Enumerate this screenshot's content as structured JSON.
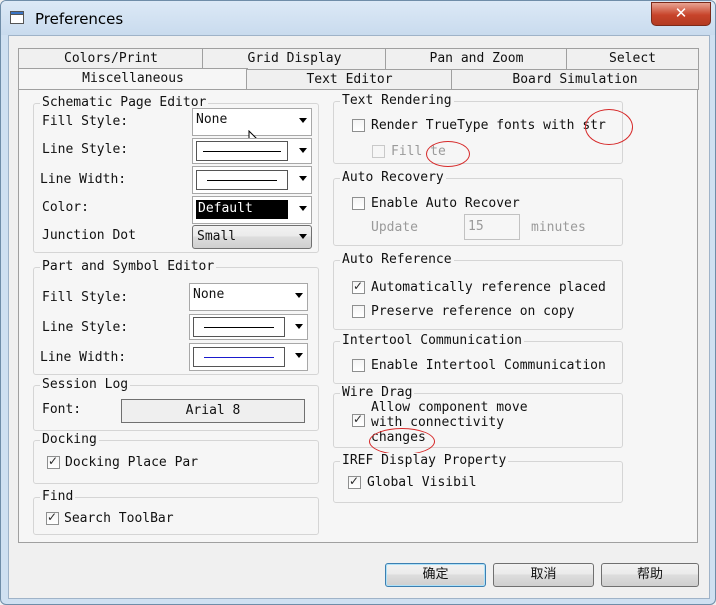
{
  "window": {
    "title": "Preferences",
    "close_glyph": "✕"
  },
  "tabs": {
    "row1": [
      "Colors/Print",
      "Grid Display",
      "Pan and Zoom",
      "Select"
    ],
    "row2": [
      "Miscellaneous",
      "Text Editor",
      "Board Simulation"
    ],
    "selected": "Miscellaneous"
  },
  "schematic": {
    "title": "Schematic Page Editor",
    "fill_style_label": "Fill Style:",
    "fill_style_value": "None",
    "line_style_label": "Line Style:",
    "line_width_label": "Line Width:",
    "color_label": "Color:",
    "color_value": "Default",
    "junction_label": "Junction Dot",
    "junction_value": "Small"
  },
  "part_symbol": {
    "title": "Part and Symbol Editor",
    "fill_style_label": "Fill Style:",
    "fill_style_value": "None",
    "line_style_label": "Line Style:",
    "line_width_label": "Line Width:"
  },
  "session_log": {
    "title": "Session Log",
    "font_label": "Font:",
    "font_button": "Arial 8"
  },
  "docking": {
    "title": "Docking",
    "checkbox_label": "Docking Place Par",
    "checked": true
  },
  "find": {
    "title": "Find",
    "checkbox_label": "Search ToolBar",
    "checked": true
  },
  "text_rendering": {
    "title": "Text Rendering",
    "render_label": "Render TrueType fonts with str",
    "render_checked": false,
    "fill_label": "Fill te",
    "fill_checked": false
  },
  "auto_recovery": {
    "title": "Auto Recovery",
    "enable_label": "Enable Auto Recover",
    "enable_checked": false,
    "update_label": "Update",
    "update_value": "15",
    "minutes_label": "minutes"
  },
  "auto_reference": {
    "title": "Auto Reference",
    "auto_label": "Automatically reference placed",
    "auto_checked": true,
    "preserve_label": "Preserve reference on copy",
    "preserve_checked": false
  },
  "intertool": {
    "title": "Intertool Communication",
    "enable_label": "Enable Intertool Communication",
    "enable_checked": false
  },
  "wire_drag": {
    "title": "Wire Drag",
    "line1": "Allow component move",
    "line2": "with connectivity",
    "line3": "changes",
    "checked": true
  },
  "iref": {
    "title": "IREF Display Property",
    "checkbox_label": "Global Visibil",
    "checked": true
  },
  "footer": {
    "ok": "确定",
    "cancel": "取消",
    "help": "帮助"
  },
  "colors": {
    "annotation_red": "#d62828",
    "line_width_blue": "#1a1acc",
    "color_swatch": "#000000"
  }
}
